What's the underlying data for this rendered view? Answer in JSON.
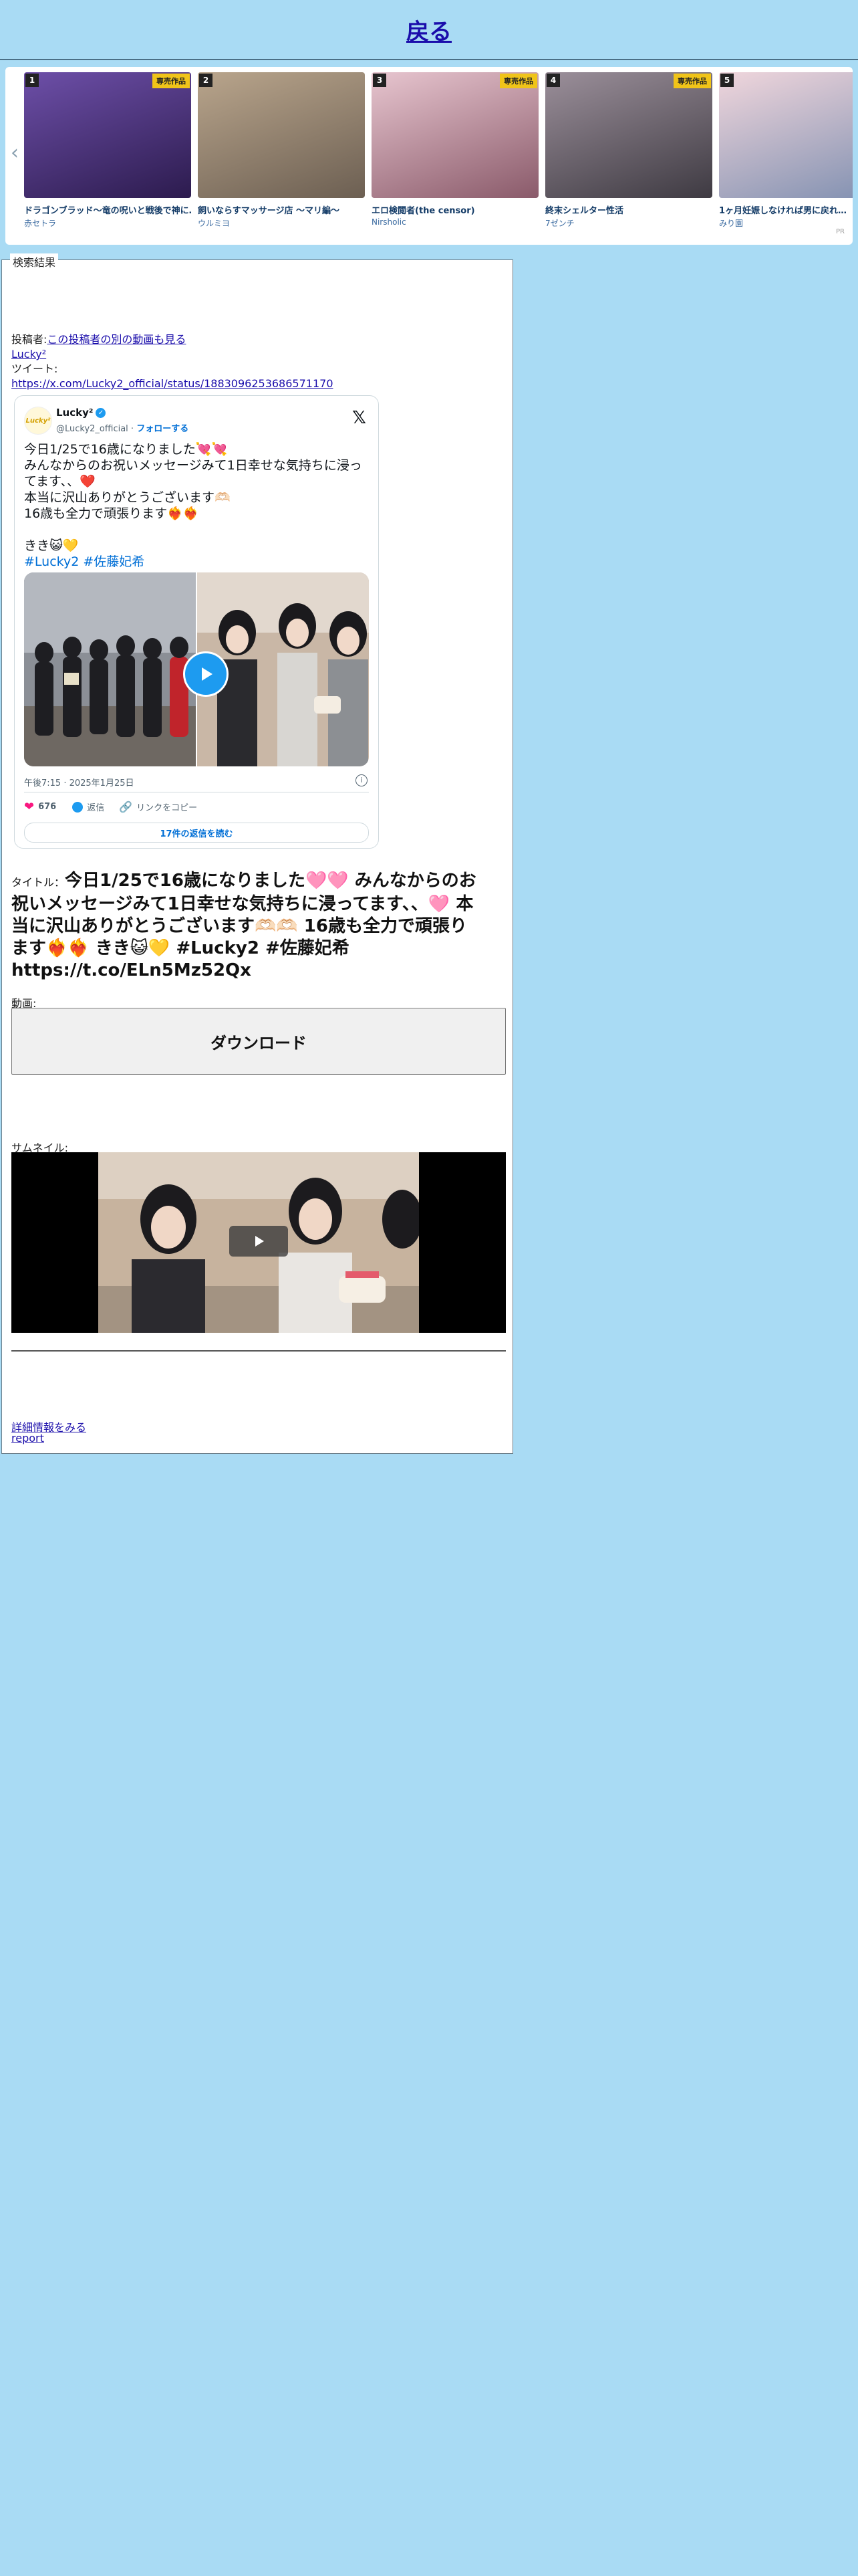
{
  "header": {
    "back_label": "戻る"
  },
  "carousel": {
    "items": [
      {
        "rank": "1",
        "badge": "専売作品",
        "title": "ドラゴンブラッド〜竜の呪いと戦後で神に…",
        "author": "赤セトラ",
        "c1": "#6d4fa8",
        "c2": "#2c1b4e"
      },
      {
        "rank": "2",
        "badge": "",
        "title": "飼いならすマッサージ店 〜マリ編〜",
        "author": "ウルミヨ",
        "c1": "#b9a58c",
        "c2": "#6c5f52"
      },
      {
        "rank": "3",
        "badge": "専売作品",
        "title": "エロ検閲者(the censor)",
        "author": "Nirsholic",
        "c1": "#e7c5cf",
        "c2": "#8a5a6a"
      },
      {
        "rank": "4",
        "badge": "専売作品",
        "title": "終末シェルター性活",
        "author": "7ゼンチ",
        "c1": "#9b8f9a",
        "c2": "#3e3a42"
      },
      {
        "rank": "5",
        "badge": "",
        "title": "1ヶ月妊娠しなければ男に戻れ…",
        "author": "みり園",
        "c1": "#f0d6dc",
        "c2": "#7f8fb0"
      }
    ],
    "pr_label": "PR",
    "prev_icon": "chevron-left-icon",
    "next_icon": "chevron-right-icon"
  },
  "result": {
    "legend": "検索結果",
    "poster_label": "投稿者:",
    "poster_link": "この投稿者の別の動画も見る",
    "poster_name": "Lucky²",
    "tweet_label": "ツイート:",
    "tweet_url": "https://x.com/Lucky2_official/status/1883096253686571170"
  },
  "tweet": {
    "avatar_text": "Lucky²",
    "name": "Lucky²",
    "handle": "@Lucky2_official",
    "dot": " · ",
    "follow": "フォローする",
    "lines": [
      "今日1/25で16歳になりました💘💘",
      "みんなからのお祝いメッセージみて1日幸せな気持ちに浸ってます、、❤️",
      "本当に沢山ありがとうございます🫶🏻",
      "16歳も全力で頑張ります❤️‍🔥❤️‍🔥",
      "",
      "きき😺💛"
    ],
    "hashtags": "#Lucky2 #佐藤妃希",
    "time": "午後7:15 · 2025年1月25日",
    "likes": "676",
    "reply": "返信",
    "copy_link": "リンクをコピー",
    "read_replies": "17件の返信を読む"
  },
  "title": {
    "label": "タイトル：",
    "text": "今日1/25で16歳になりました🩷🩷 みんなからのお祝いメッセージみて1日幸せな気持ちに浸ってます、、🩷 本当に沢山ありがとうございます🫶🏻🫶🏻 16歳も全力で頑張ります❤️‍🔥❤️‍🔥 きき😺💛 #Lucky2 #佐藤妃希 https://t.co/ELn5Mz52Qx"
  },
  "video": {
    "label": "動画:",
    "download": "ダウンロード"
  },
  "thumbnail": {
    "label": "サムネイル:"
  },
  "footer": {
    "more": "詳細情報をみる",
    "report": "report"
  },
  "colors": {
    "page_bg": "#a9dbf4",
    "tweet_blue": "#1d9bf0",
    "heart": "#f91880",
    "badge": "#f0c419"
  }
}
